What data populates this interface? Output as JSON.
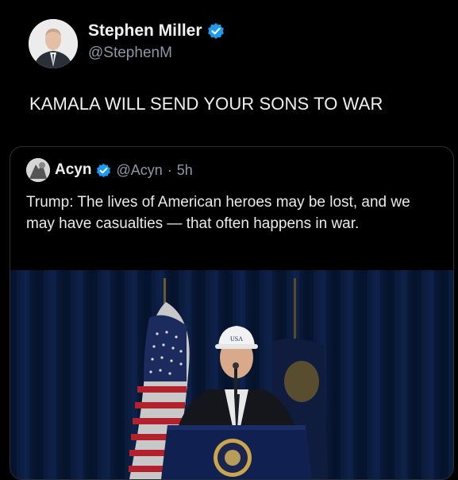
{
  "author": {
    "name": "Stephen Miller",
    "handle": "@StephenM",
    "verified": true
  },
  "tweet_text": "KAMALA WILL SEND YOUR SONS TO WAR",
  "quoted": {
    "name": "Acyn",
    "handle": "@Acyn",
    "separator": "·",
    "time": "5h",
    "verified": true,
    "text": "Trump: The lives of American heroes may be lost, and we may have casualties — that often happens in war.",
    "media": {
      "description_icon": "video-still",
      "hat_text": "USA"
    }
  },
  "colors": {
    "background": "#000000",
    "text": "#e7e9ea",
    "muted": "#8b98a5",
    "verified_blue": "#1d9bf0",
    "border": "#2a2f33"
  }
}
